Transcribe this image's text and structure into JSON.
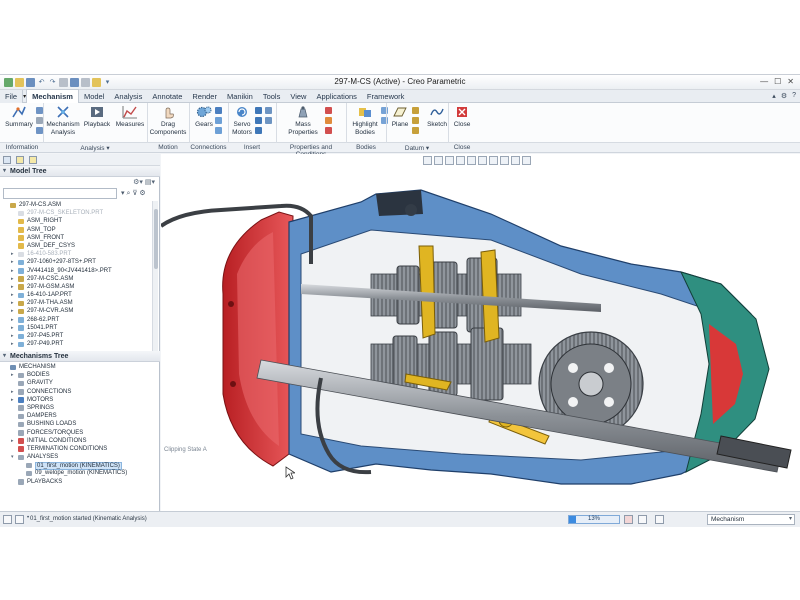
{
  "window": {
    "title": "297-M-CS (Active) - Creo Parametric"
  },
  "tabs": [
    {
      "label": "File",
      "active": false
    },
    {
      "label": "Mechanism",
      "active": true
    },
    {
      "label": "Model",
      "active": false
    },
    {
      "label": "Analysis",
      "active": false
    },
    {
      "label": "Annotate",
      "active": false
    },
    {
      "label": "Render",
      "active": false
    },
    {
      "label": "Manikin",
      "active": false
    },
    {
      "label": "Tools",
      "active": false
    },
    {
      "label": "View",
      "active": false
    },
    {
      "label": "Applications",
      "active": false
    },
    {
      "label": "Framework",
      "active": false
    }
  ],
  "ribbon": {
    "summary": "Summary",
    "mechanism_analysis_1": "Mechanism",
    "mechanism_analysis_2": "Analysis",
    "playback": "Playback",
    "measures": "Measures",
    "drag_components_1": "Drag",
    "drag_components_2": "Components",
    "gears": "Gears",
    "servo_motors_1": "Servo",
    "servo_motors_2": "Motors",
    "mass_properties_1": "Mass",
    "mass_properties_2": "Properties",
    "highlight_bodies_1": "Highlight",
    "highlight_bodies_2": "Bodies",
    "plane": "Plane",
    "sketch": "Sketch",
    "close": "Close"
  },
  "groups": {
    "information": "Information",
    "analysis": "Analysis",
    "motion": "Motion",
    "connections": "Connections",
    "insert": "Insert",
    "properties": "Properties and Conditions",
    "bodies": "Bodies",
    "datum": "Datum",
    "close": "Close"
  },
  "model_tree": {
    "title": "Model Tree",
    "items": [
      {
        "label": "297-M-CS.ASM",
        "level": 0,
        "exp": "",
        "dim": false,
        "icon": "#c9a84a"
      },
      {
        "label": "297-M-CS_SKELETON.PRT",
        "level": 1,
        "exp": "",
        "dim": true,
        "icon": "#d9dde3"
      },
      {
        "label": "ASM_RIGHT",
        "level": 1,
        "exp": "",
        "dim": false,
        "icon": "#e2b94a"
      },
      {
        "label": "ASM_TOP",
        "level": 1,
        "exp": "",
        "dim": false,
        "icon": "#e2b94a"
      },
      {
        "label": "ASM_FRONT",
        "level": 1,
        "exp": "",
        "dim": false,
        "icon": "#e2b94a"
      },
      {
        "label": "ASM_DEF_CSYS",
        "level": 1,
        "exp": "",
        "dim": false,
        "icon": "#e2b94a"
      },
      {
        "label": "16-410-583.PRT",
        "level": 1,
        "exp": "▸",
        "dim": true,
        "icon": "#d9dde3"
      },
      {
        "label": "297-1060+297-8TS+.PRT",
        "level": 1,
        "exp": "▸",
        "dim": false,
        "icon": "#7fb0d8"
      },
      {
        "label": "JV441418_90<JV441418>.PRT",
        "level": 1,
        "exp": "▸",
        "dim": false,
        "icon": "#7fb0d8"
      },
      {
        "label": "297-M-CSC.ASM",
        "level": 1,
        "exp": "▸",
        "dim": false,
        "icon": "#c9a84a"
      },
      {
        "label": "297-M-GSM.ASM",
        "level": 1,
        "exp": "▸",
        "dim": false,
        "icon": "#c9a84a"
      },
      {
        "label": "16-410-1AP.PRT",
        "level": 1,
        "exp": "▸",
        "dim": false,
        "icon": "#7fb0d8"
      },
      {
        "label": "297-M-THA.ASM",
        "level": 1,
        "exp": "▸",
        "dim": false,
        "icon": "#c9a84a"
      },
      {
        "label": "297-M-CVR.ASM",
        "level": 1,
        "exp": "▸",
        "dim": false,
        "icon": "#c9a84a"
      },
      {
        "label": "268-62.PRT",
        "level": 1,
        "exp": "▸",
        "dim": false,
        "icon": "#7fb0d8"
      },
      {
        "label": "15041.PRT",
        "level": 1,
        "exp": "▸",
        "dim": false,
        "icon": "#7fb0d8"
      },
      {
        "label": "297-P45.PRT",
        "level": 1,
        "exp": "▸",
        "dim": false,
        "icon": "#7fb0d8"
      },
      {
        "label": "297-P49.PRT",
        "level": 1,
        "exp": "▸",
        "dim": false,
        "icon": "#7fb0d8"
      }
    ]
  },
  "mech_tree": {
    "title": "Mechanisms Tree",
    "items": [
      {
        "label": "MECHANISM",
        "level": 0,
        "exp": "",
        "sel": false,
        "icon": "#6f8fb4"
      },
      {
        "label": "BODIES",
        "level": 1,
        "exp": "▸",
        "sel": false,
        "icon": "#9aa7b7"
      },
      {
        "label": "GRAVITY",
        "level": 1,
        "exp": "",
        "sel": false,
        "icon": "#9aa7b7"
      },
      {
        "label": "CONNECTIONS",
        "level": 1,
        "exp": "▸",
        "sel": false,
        "icon": "#9aa7b7"
      },
      {
        "label": "MOTORS",
        "level": 1,
        "exp": "▸",
        "sel": false,
        "icon": "#4b7fc0"
      },
      {
        "label": "SPRINGS",
        "level": 1,
        "exp": "",
        "sel": false,
        "icon": "#9aa7b7"
      },
      {
        "label": "DAMPERS",
        "level": 1,
        "exp": "",
        "sel": false,
        "icon": "#9aa7b7"
      },
      {
        "label": "BUSHING LOADS",
        "level": 1,
        "exp": "",
        "sel": false,
        "icon": "#9aa7b7"
      },
      {
        "label": "FORCES/TORQUES",
        "level": 1,
        "exp": "",
        "sel": false,
        "icon": "#9aa7b7"
      },
      {
        "label": "INITIAL CONDITIONS",
        "level": 1,
        "exp": "▸",
        "sel": false,
        "icon": "#d24f4f"
      },
      {
        "label": "TERMINATION CONDITIONS",
        "level": 1,
        "exp": "",
        "sel": false,
        "icon": "#d24f4f"
      },
      {
        "label": "ANALYSES",
        "level": 1,
        "exp": "▾",
        "sel": false,
        "icon": "#9aa7b7"
      },
      {
        "label": "01_first_motion (KINEMATICS)",
        "level": 2,
        "exp": "",
        "sel": true,
        "icon": "#9aa7b7"
      },
      {
        "label": "09_welope_motion (KINEMATICS)",
        "level": 2,
        "exp": "",
        "sel": false,
        "icon": "#9aa7b7"
      },
      {
        "label": "PLAYBACKS",
        "level": 1,
        "exp": "",
        "sel": false,
        "icon": "#9aa7b7"
      }
    ]
  },
  "graphics": {
    "clipping_state": "Clipping State A"
  },
  "status": {
    "message": "01_first_motion started (Kinematic Analysis)",
    "progress_label": "13%",
    "progress_fraction": 0.13,
    "mode": "Mechanism"
  },
  "colors": {
    "housing_red": "#d9383a",
    "gear_gray": "#8e949b",
    "fork_yellow": "#e0b522",
    "cut_blue": "#3f6fb0",
    "teal": "#2c8a7c",
    "shaft": "#9ea3a8"
  },
  "icons": [
    "summary-icon",
    "mechanism-analysis-icon",
    "playback-icon",
    "measures-icon",
    "drag-components-icon",
    "gears-icon",
    "servo-motors-icon",
    "mass-properties-icon",
    "highlight-bodies-icon",
    "plane-icon",
    "sketch-icon",
    "close-icon"
  ]
}
